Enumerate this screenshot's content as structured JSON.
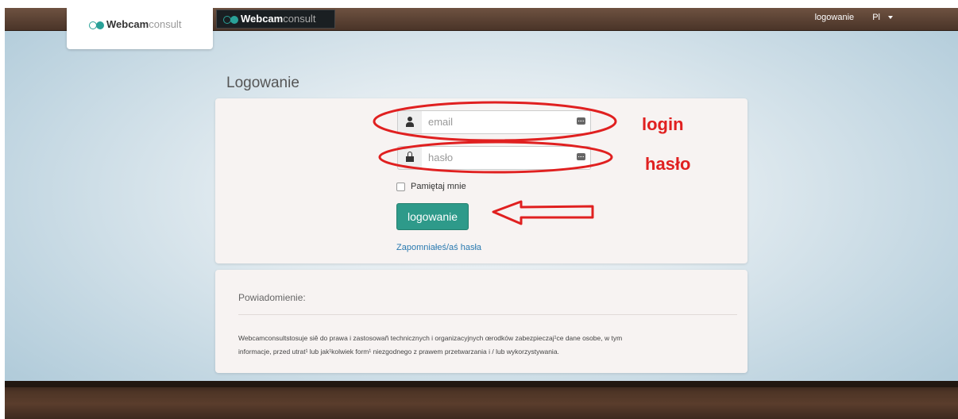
{
  "header": {
    "logo_bold": "Webcam",
    "logo_light": "consult",
    "logo_dark_bold": "Webcam",
    "logo_dark_light": "consult",
    "nav_login": "logowanie",
    "nav_lang": "Pl"
  },
  "login": {
    "title": "Logowanie",
    "email_placeholder": "email",
    "password_placeholder": "hasło",
    "remember_label": "Pamiętaj mnie",
    "submit_label": "logowanie",
    "forgot_link": "Zapomniałeś/aś hasła"
  },
  "notice": {
    "title": "Powiadomienie:",
    "line1": "Webcamconsultstosuje siê do prawa i zastosowañ technicznych i organizacyjnych œrodków zabezpieczaj¹ce dane osobe, w tym",
    "line2": "informacje, przed utrat¹ lub jak¹kolwiek form¹ niezgodnego z prawem przetwarzania i / lub wykorzystywania."
  },
  "annotations": {
    "login_label": "login",
    "password_label": "hasło",
    "color": "#e02020"
  },
  "colors": {
    "accent": "#2e9a8a",
    "link": "#2a7ab0"
  }
}
